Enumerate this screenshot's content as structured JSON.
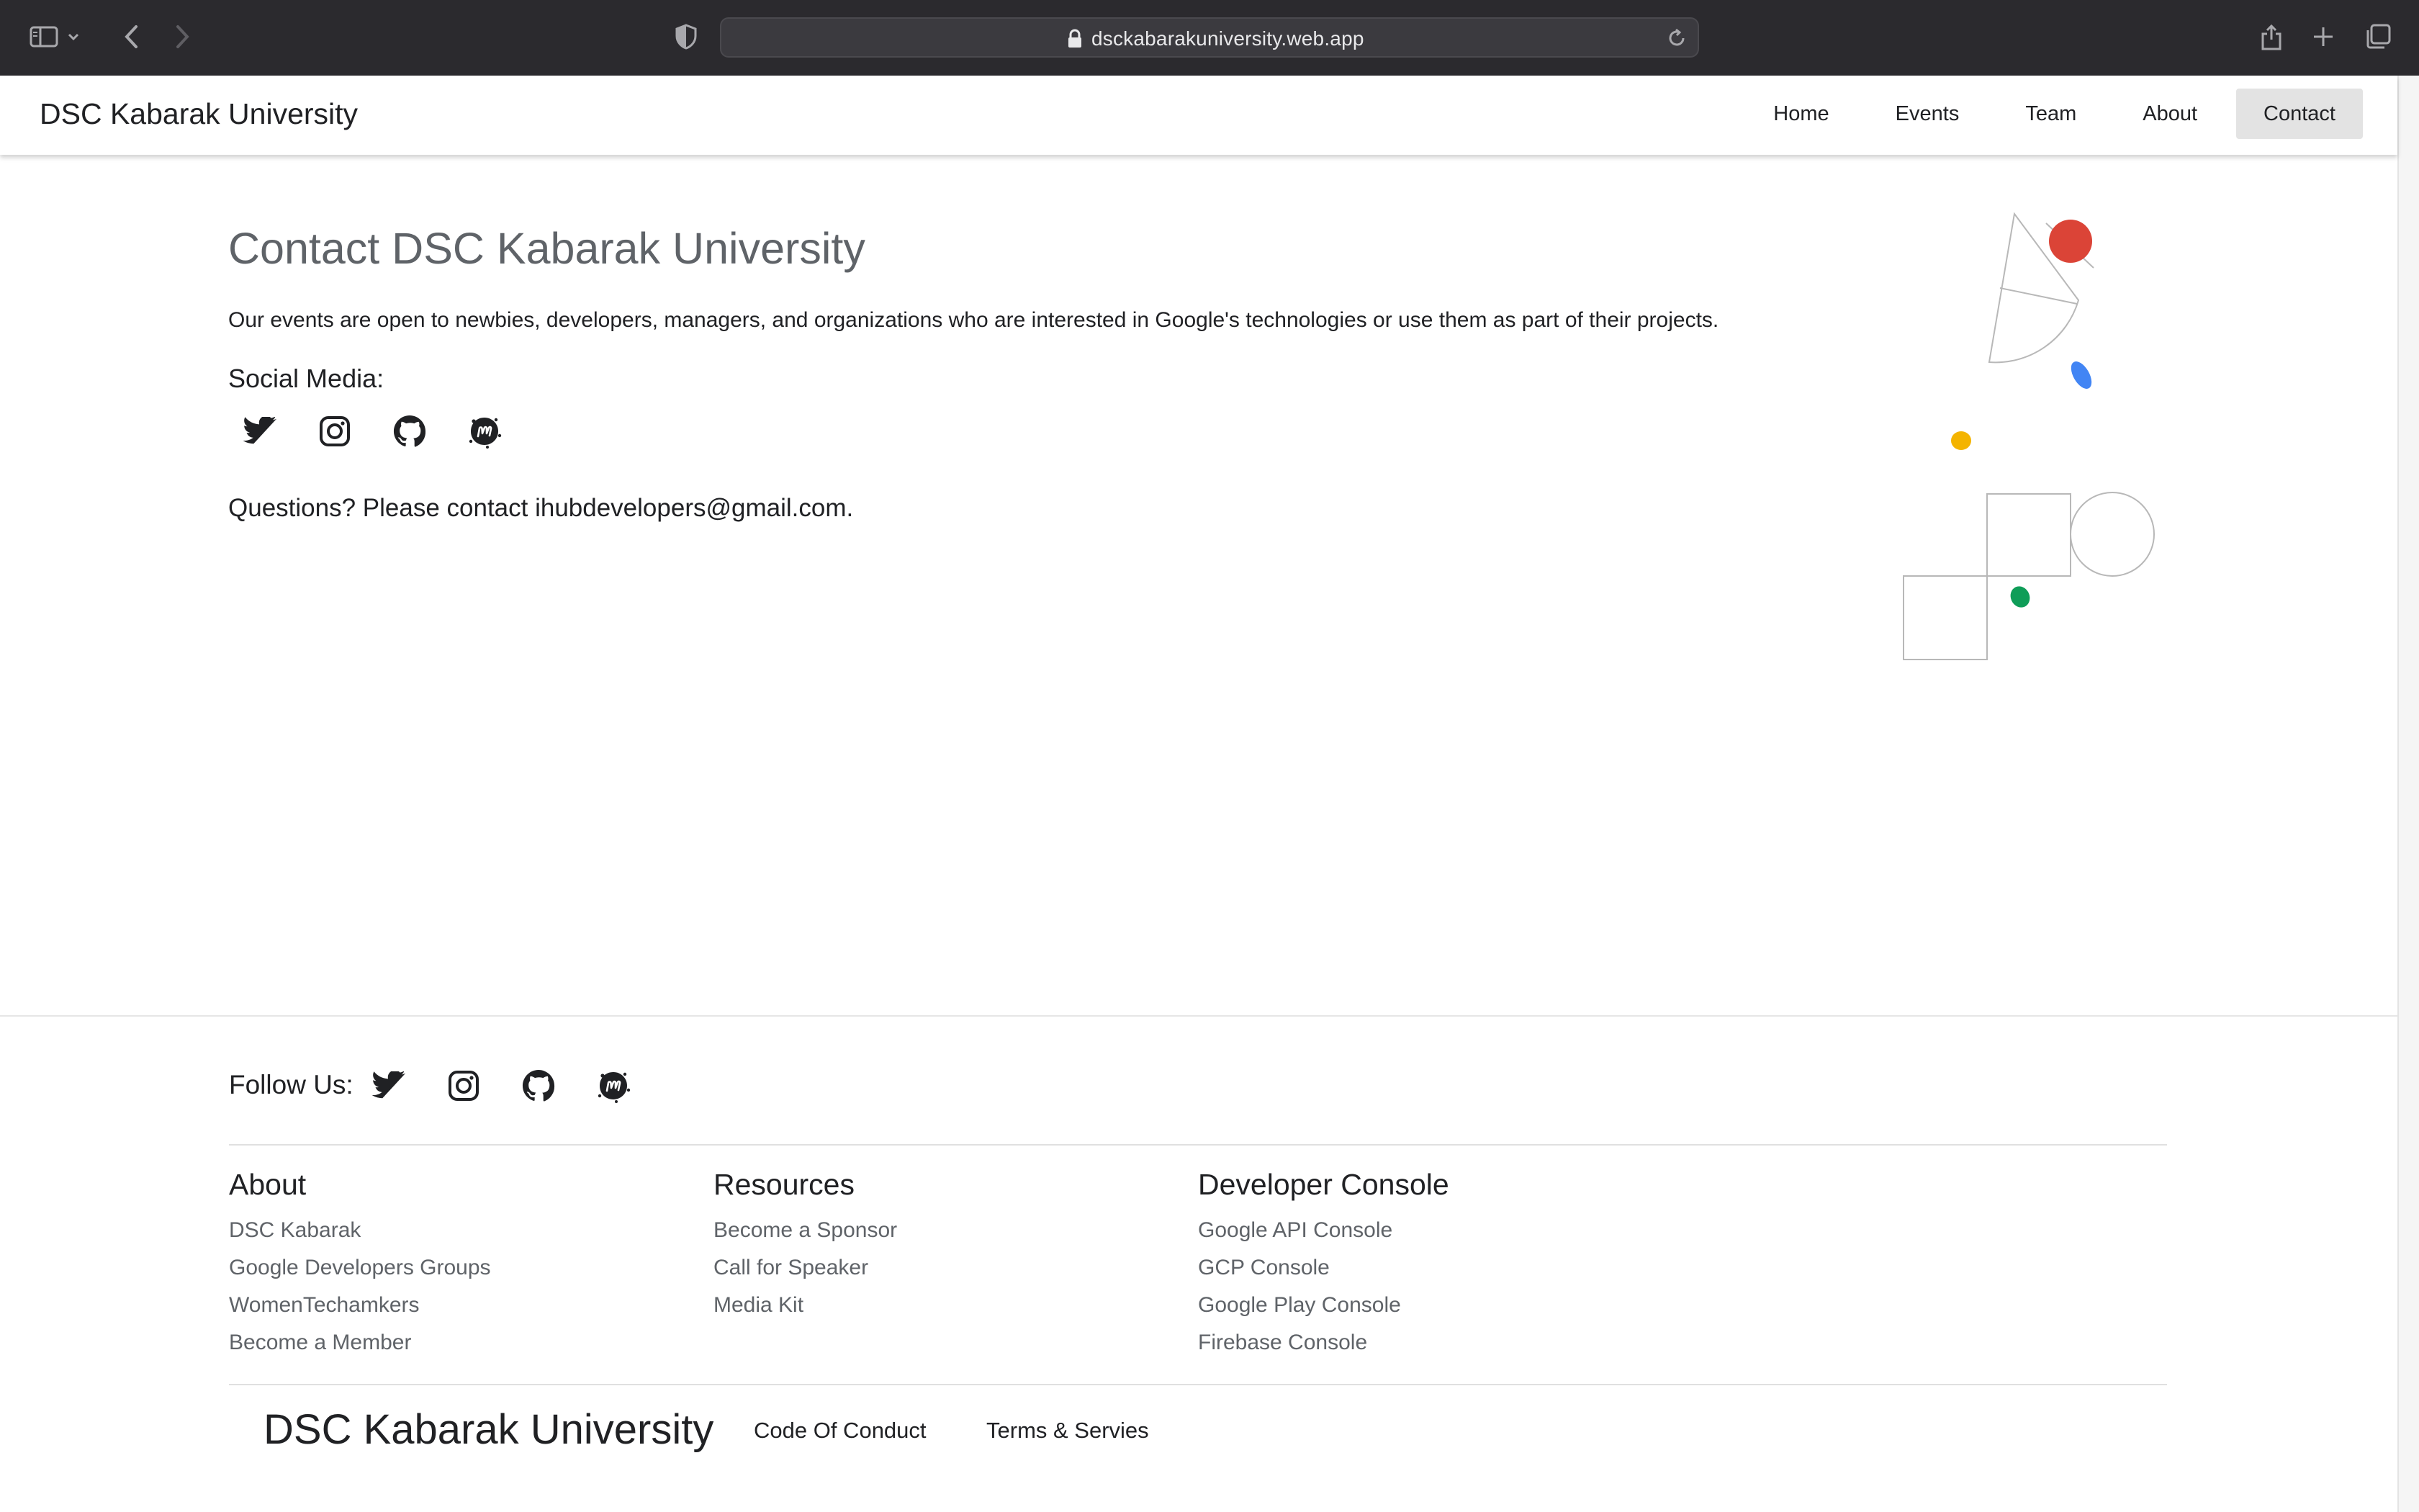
{
  "browser": {
    "url": "dsckabarakuniversity.web.app"
  },
  "header": {
    "brand": "DSC Kabarak University",
    "nav": [
      "Home",
      "Events",
      "Team",
      "About",
      "Contact"
    ],
    "active_nav": "Contact"
  },
  "main": {
    "title": "Contact DSC Kabarak University",
    "intro": "Our events are open to newbies, developers, managers, and organizations who are interested in Google's technologies or use them as part of their projects.",
    "social_label": "Social Media:",
    "social_icons": [
      "twitter-icon",
      "instagram-icon",
      "github-icon",
      "meetup-icon"
    ],
    "questions": "Questions? Please contact ihubdevelopers@gmail.com."
  },
  "footer": {
    "follow_label": "Follow Us:",
    "columns": [
      {
        "heading": "About",
        "links": [
          "DSC Kabarak",
          "Google Developers Groups",
          "WomenTechamkers",
          "Become a Member"
        ]
      },
      {
        "heading": "Resources",
        "links": [
          "Become a Sponsor",
          "Call for Speaker",
          "Media Kit"
        ]
      },
      {
        "heading": "Developer Console",
        "links": [
          "Google API Console",
          "GCP Console",
          "Google Play Console",
          "Firebase Console"
        ]
      }
    ],
    "brand": "DSC Kabarak University",
    "bottom_links": [
      "Code Of Conduct",
      "Terms & Servies"
    ]
  },
  "colors": {
    "red": "#db4437",
    "blue": "#4285f4",
    "yellow": "#f4b400",
    "green": "#0f9d58"
  }
}
